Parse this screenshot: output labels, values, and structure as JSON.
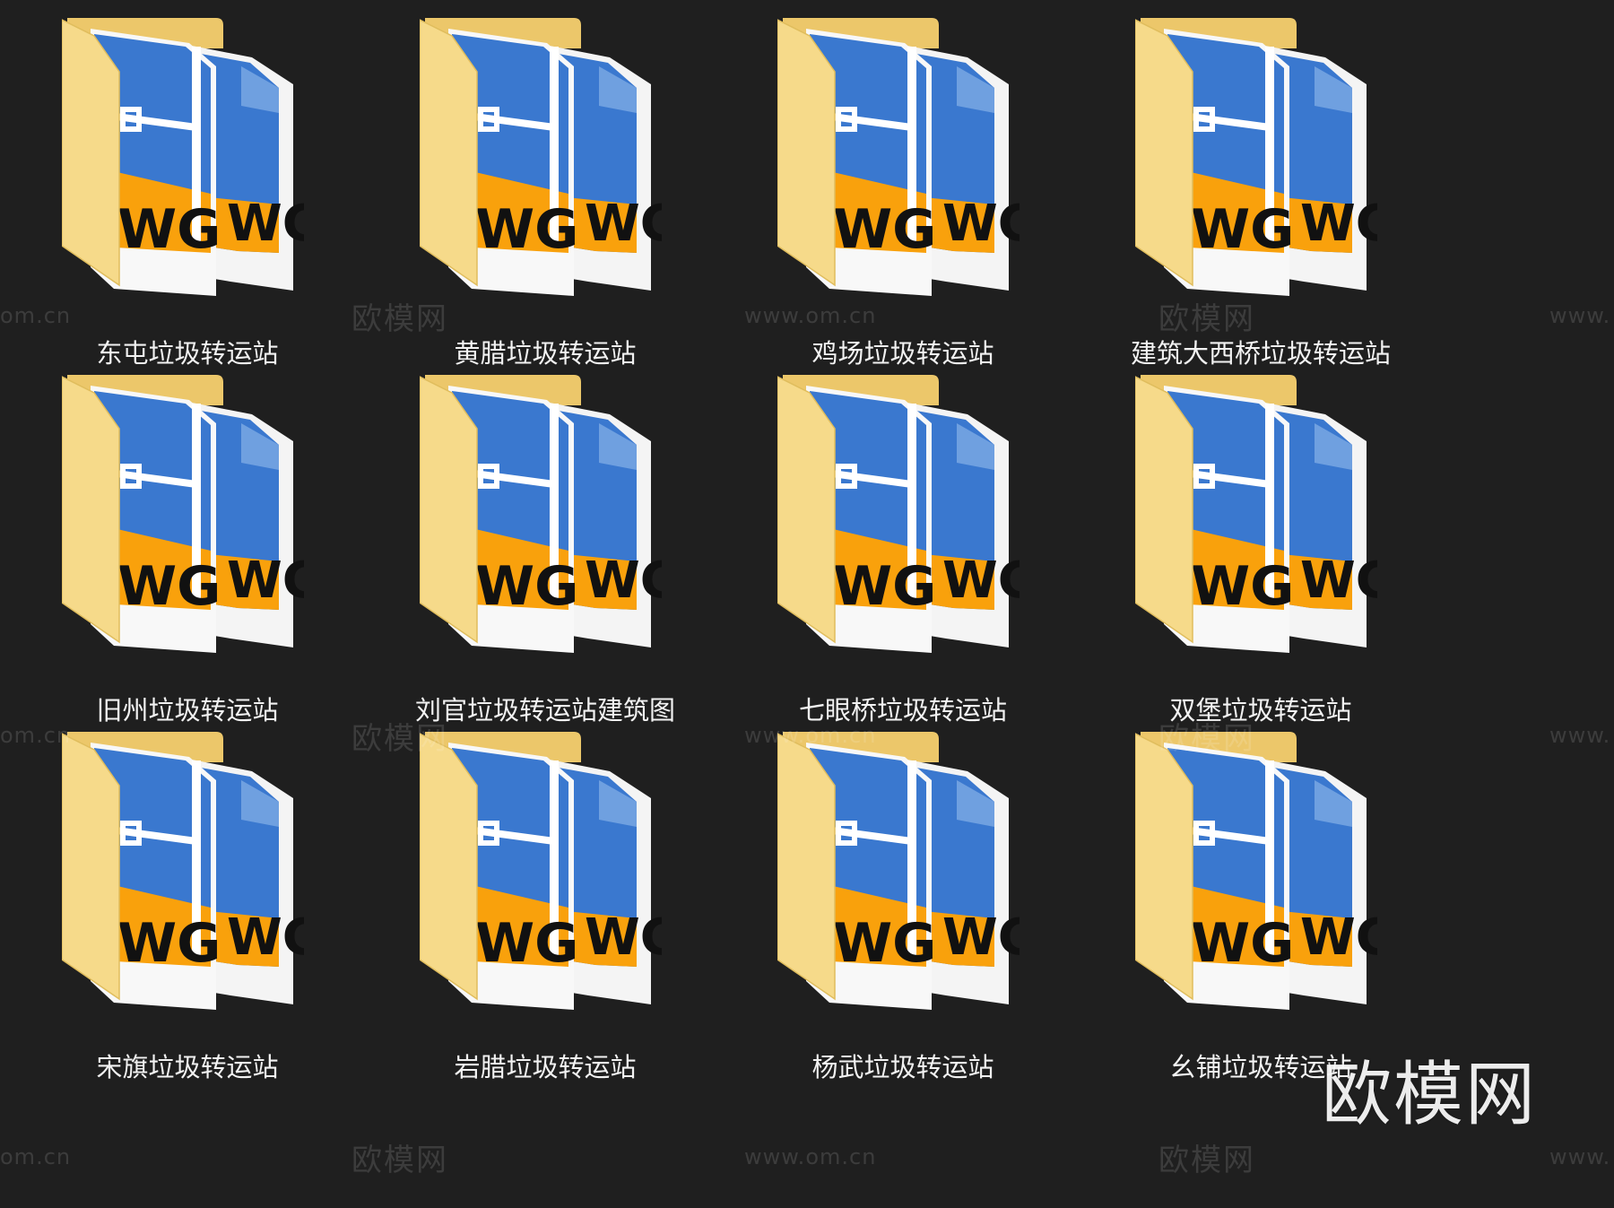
{
  "folders": [
    {
      "label": "东屯垃圾转运站",
      "icon": "dwg-folder-icon"
    },
    {
      "label": "黄腊垃圾转运站",
      "icon": "dwg-folder-icon"
    },
    {
      "label": "鸡场垃圾转运站",
      "icon": "dwg-folder-icon"
    },
    {
      "label": "建筑大西桥垃圾转运站",
      "icon": "dwg-folder-icon"
    },
    {
      "label": "旧州垃圾转运站",
      "icon": "dwg-folder-icon"
    },
    {
      "label": "刘官垃圾转运站建筑图",
      "icon": "dwg-folder-icon"
    },
    {
      "label": "七眼桥垃圾转运站",
      "icon": "dwg-folder-icon"
    },
    {
      "label": "双堡垃圾转运站",
      "icon": "dwg-folder-icon"
    },
    {
      "label": "宋旗垃圾转运站",
      "icon": "dwg-folder-icon"
    },
    {
      "label": "岩腊垃圾转运站",
      "icon": "dwg-folder-icon"
    },
    {
      "label": "杨武垃圾转运站",
      "icon": "dwg-folder-icon"
    },
    {
      "label": "幺铺垃圾转运站",
      "icon": "dwg-folder-icon"
    }
  ],
  "thumbnail": {
    "doc_text": "WG",
    "doc_watermark": "www.om.cn",
    "doc_watermark_cn": "欧模网"
  },
  "watermark": {
    "brand": "欧模网",
    "url": "www.om.cn",
    "url_partial_left": "om.cn",
    "url_partial_right": "www."
  },
  "colors": {
    "background": "#1f1f1f",
    "folder_front": "#f7dd8c",
    "folder_back": "#e9c45e",
    "doc_blue": "#3a78cf",
    "doc_orange": "#f9a10c",
    "label_text": "#f2f2f2"
  }
}
